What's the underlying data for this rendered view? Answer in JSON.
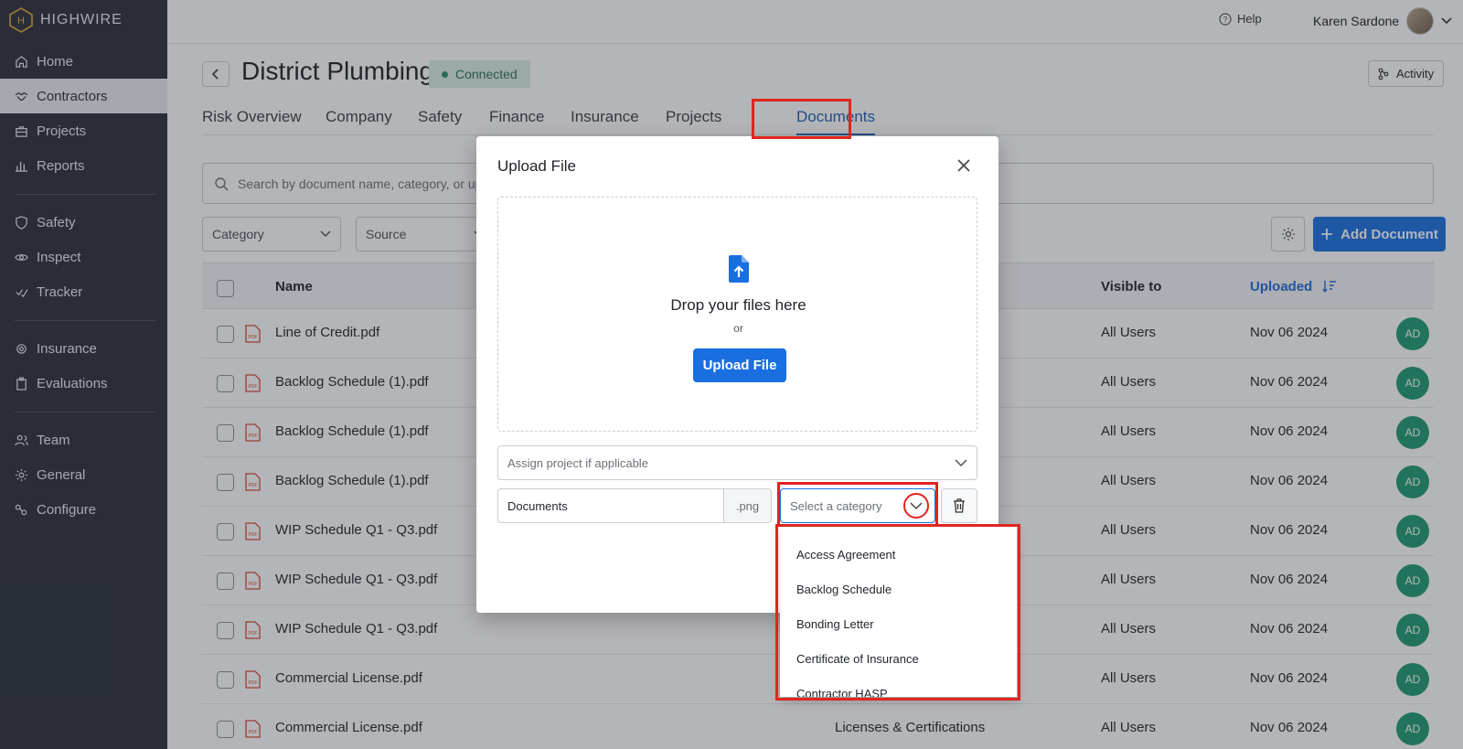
{
  "app": {
    "name": "HIGHWIRE"
  },
  "sidebar": {
    "items": [
      {
        "label": "Home",
        "icon": "home-icon"
      },
      {
        "label": "Contractors",
        "icon": "handshake-icon"
      },
      {
        "label": "Projects",
        "icon": "briefcase-icon"
      },
      {
        "label": "Reports",
        "icon": "bar-chart-icon"
      },
      {
        "label": "Safety",
        "icon": "shield-icon"
      },
      {
        "label": "Inspect",
        "icon": "eye-icon"
      },
      {
        "label": "Tracker",
        "icon": "check-icon"
      },
      {
        "label": "Insurance",
        "icon": "gear-badge-icon"
      },
      {
        "label": "Evaluations",
        "icon": "clipboard-icon"
      },
      {
        "label": "Team",
        "icon": "users-icon"
      },
      {
        "label": "General",
        "icon": "settings-icon"
      },
      {
        "label": "Configure",
        "icon": "configure-icon"
      }
    ],
    "active": "Contractors"
  },
  "topbar": {
    "help_label": "Help",
    "user_name": "Karen Sardone"
  },
  "header": {
    "title": "District Plumbing",
    "status": "Connected",
    "activity_label": "Activity"
  },
  "tabs": [
    "Risk Overview",
    "Company",
    "Safety",
    "Finance",
    "Insurance",
    "Projects",
    "Documents"
  ],
  "active_tab": "Documents",
  "search": {
    "placeholder": "Search by document name, category, or uplo"
  },
  "filters": {
    "category": "Category",
    "source": "Source"
  },
  "add_document_label": "Add Document",
  "table": {
    "columns": {
      "name": "Name",
      "visible_to": "Visible to",
      "uploaded": "Uploaded"
    },
    "rows": [
      {
        "name": "Line of Credit.pdf",
        "category": "",
        "visible_to": "All Users",
        "uploaded": "Nov 06 2024",
        "uploader": "AD"
      },
      {
        "name": "Backlog Schedule (1).pdf",
        "category": "",
        "visible_to": "All Users",
        "uploaded": "Nov 06 2024",
        "uploader": "AD"
      },
      {
        "name": "Backlog Schedule (1).pdf",
        "category": "",
        "visible_to": "All Users",
        "uploaded": "Nov 06 2024",
        "uploader": "AD"
      },
      {
        "name": "Backlog Schedule (1).pdf",
        "category": "",
        "visible_to": "All Users",
        "uploaded": "Nov 06 2024",
        "uploader": "AD"
      },
      {
        "name": "WIP Schedule Q1 - Q3.pdf",
        "category": "",
        "visible_to": "All Users",
        "uploaded": "Nov 06 2024",
        "uploader": "AD"
      },
      {
        "name": "WIP Schedule Q1 - Q3.pdf",
        "category": "",
        "visible_to": "All Users",
        "uploaded": "Nov 06 2024",
        "uploader": "AD"
      },
      {
        "name": "WIP Schedule Q1 - Q3.pdf",
        "category": "",
        "visible_to": "All Users",
        "uploaded": "Nov 06 2024",
        "uploader": "AD"
      },
      {
        "name": "Commercial License.pdf",
        "category": "",
        "visible_to": "All Users",
        "uploaded": "Nov 06 2024",
        "uploader": "AD"
      },
      {
        "name": "Commercial License.pdf",
        "category": "Licenses & Certifications",
        "visible_to": "All Users",
        "uploaded": "Nov 06 2024",
        "uploader": "AD"
      }
    ]
  },
  "modal": {
    "title": "Upload File",
    "drop_text": "Drop your files here",
    "or_text": "or",
    "upload_button": "Upload File",
    "assign_placeholder": "Assign project if applicable",
    "file_name": "Documents",
    "extension": ".png",
    "category_placeholder": "Select a category"
  },
  "category_options": [
    "Access Agreement",
    "Backlog Schedule",
    "Bonding Letter",
    "Certificate of Insurance",
    "Contractor HASP"
  ],
  "colors": {
    "primary": "#1a6fe0",
    "sidebar": "#2b2f3a",
    "highlight": "#e0251f",
    "badge": "#1f9a74"
  }
}
